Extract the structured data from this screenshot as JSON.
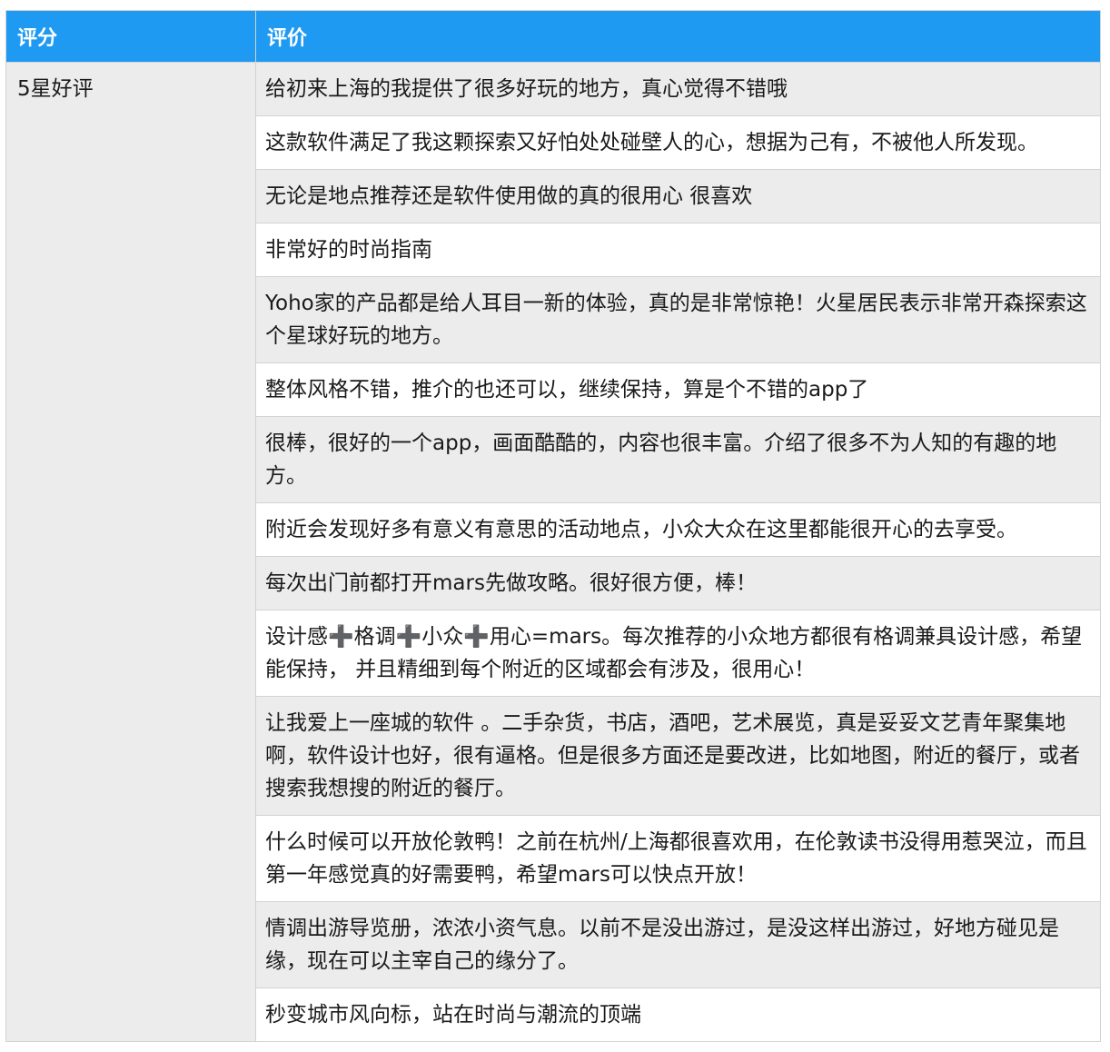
{
  "header": {
    "score": "评分",
    "review": "评价"
  },
  "rating_label": "5星好评",
  "reviews": [
    "给初来上海的我提供了很多好玩的地方，真心觉得不错哦",
    "这款软件满足了我这颗探索又好怕处处碰壁人的心，想据为己有，不被他人所发现。",
    "无论是地点推荐还是软件使用做的真的很用心 很喜欢",
    "非常好的时尚指南",
    "Yoho家的产品都是给人耳目一新的体验，真的是非常惊艳！火星居民表示非常开森探索这个星球好玩的地方。",
    "整体风格不错，推介的也还可以，继续保持，算是个不错的app了",
    "很棒，很好的一个app，画面酷酷的，内容也很丰富。介绍了很多不为人知的有趣的地方。",
    "附近会发现好多有意义有意思的活动地点，小众大众在这里都能很开心的去享受。",
    "每次出门前都打开mars先做攻略。很好很方便，棒！",
    "设计感➕格调➕小众➕用心=mars。每次推荐的小众地方都很有格调兼具设计感，希望能保持， 并且精细到每个附近的区域都会有涉及，很用心！",
    "让我爱上一座城的软件 。二手杂货，书店，酒吧，艺术展览，真是妥妥文艺青年聚集地啊，软件设计也好，很有逼格。但是很多方面还是要改进，比如地图，附近的餐厅，或者搜索我想搜的附近的餐厅。",
    "什么时候可以开放伦敦鸭！之前在杭州/上海都很喜欢用，在伦敦读书没得用惹哭泣，而且第一年感觉真的好需要鸭，希望mars可以快点开放！",
    "情调出游导览册，浓浓小资气息。以前不是没出游过，是没这样出游过，好地方碰见是缘，现在可以主宰自己的缘分了。",
    "秒变城市风向标，站在时尚与潮流的顶端"
  ],
  "colors": {
    "header_bg": "#1e9af3",
    "stripe": "#ececec",
    "border": "#d3d3d3"
  }
}
